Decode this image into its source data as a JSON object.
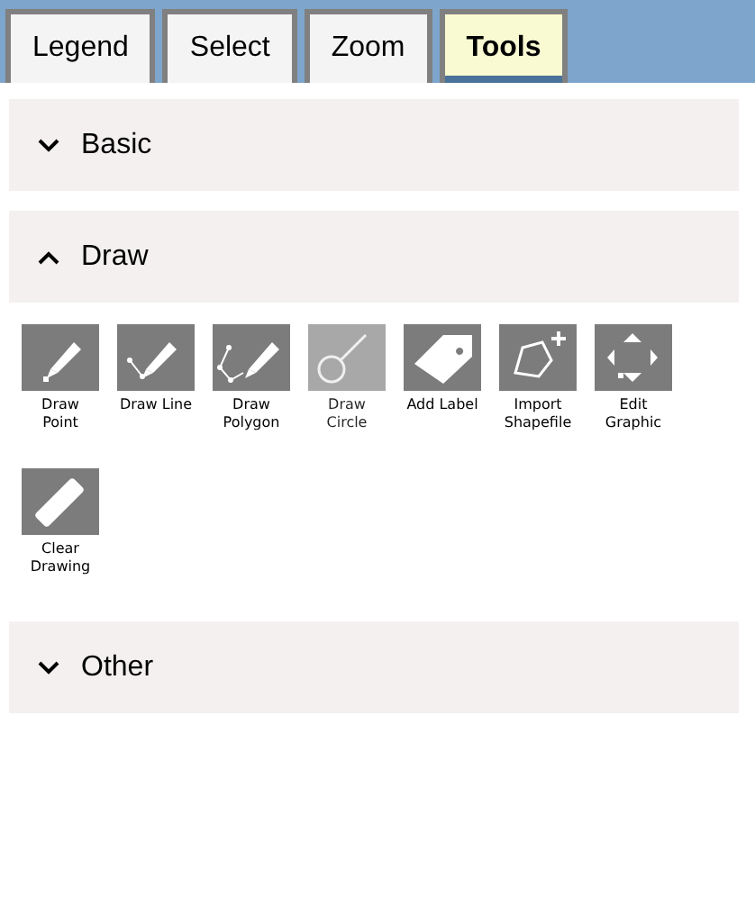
{
  "tabs": [
    {
      "label": "Legend",
      "selected": false
    },
    {
      "label": "Select",
      "selected": false
    },
    {
      "label": "Zoom",
      "selected": false
    },
    {
      "label": "Tools",
      "selected": true
    }
  ],
  "sections": [
    {
      "title": "Basic",
      "expanded": false
    },
    {
      "title": "Draw",
      "expanded": true,
      "tools": [
        {
          "kind": "point",
          "label": "Draw Point",
          "disabled": false
        },
        {
          "kind": "line",
          "label": "Draw Line",
          "disabled": false
        },
        {
          "kind": "polygon",
          "label": "Draw Polygon",
          "disabled": false
        },
        {
          "kind": "circle",
          "label": "Draw Circle",
          "disabled": true
        },
        {
          "kind": "label",
          "label": "Add Label",
          "disabled": false
        },
        {
          "kind": "import",
          "label": "Import Shapefile",
          "disabled": false
        },
        {
          "kind": "edit",
          "label": "Edit Graphic",
          "disabled": false
        },
        {
          "kind": "clear",
          "label": "Clear Drawing",
          "disabled": false
        }
      ]
    },
    {
      "title": "Other",
      "expanded": false
    }
  ]
}
